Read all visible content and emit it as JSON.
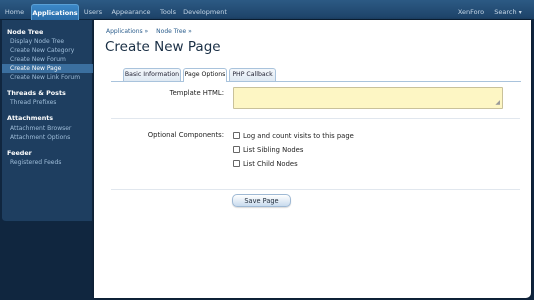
{
  "topnav": {
    "items": [
      "Home",
      "Applications",
      "Users",
      "Appearance",
      "Tools",
      "Development"
    ],
    "active": "Applications",
    "right": [
      "XenForo",
      "Search"
    ]
  },
  "sidebar": {
    "sections": [
      {
        "title": "Node Tree",
        "items": [
          "Display Node Tree",
          "Create New Category",
          "Create New Forum",
          "Create New Page",
          "Create New Link Forum"
        ]
      },
      {
        "title": "Threads & Posts",
        "items": [
          "Thread Prefixes"
        ]
      },
      {
        "title": "Attachments",
        "items": [
          "Attachment Browser",
          "Attachment Options"
        ]
      },
      {
        "title": "Feeder",
        "items": [
          "Registered Feeds"
        ]
      }
    ],
    "selected": "Create New Page"
  },
  "breadcrumb": [
    "Applications »",
    "Node Tree »"
  ],
  "page_title": "Create New Page",
  "tabs": [
    "Basic Information",
    "Page Options",
    "PHP Callback"
  ],
  "active_tab": "Page Options",
  "form": {
    "template_label": "Template HTML:",
    "template_value": "",
    "optional_label": "Optional Components:",
    "options": [
      {
        "label": "Log and count visits to this page",
        "checked": false
      },
      {
        "label": "List Sibling Nodes",
        "checked": false
      },
      {
        "label": "List Child Nodes",
        "checked": false
      }
    ],
    "submit": "Save Page"
  }
}
